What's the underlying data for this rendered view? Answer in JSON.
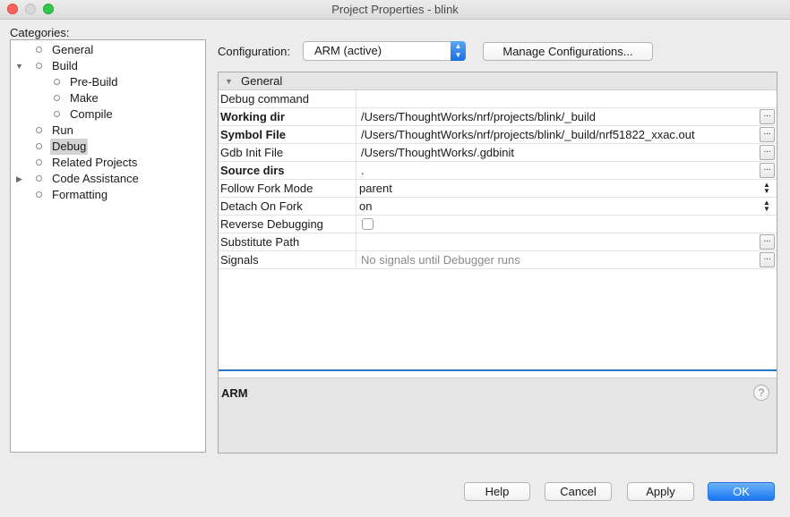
{
  "window": {
    "title": "Project Properties - blink"
  },
  "categories": {
    "label": "Categories:",
    "items": [
      {
        "label": "General"
      },
      {
        "label": "Build"
      },
      {
        "label": "Pre-Build"
      },
      {
        "label": "Make"
      },
      {
        "label": "Compile"
      },
      {
        "label": "Run"
      },
      {
        "label": "Debug",
        "selected": true
      },
      {
        "label": "Related Projects"
      },
      {
        "label": "Code Assistance"
      },
      {
        "label": "Formatting"
      }
    ]
  },
  "configuration": {
    "label": "Configuration:",
    "selected": "ARM (active)",
    "manage_label": "Manage Configurations..."
  },
  "sheet": {
    "group": "General",
    "rows": [
      {
        "name": "Debug command",
        "value": ""
      },
      {
        "name": "Working dir",
        "value": "/Users/ThoughtWorks/nrf/projects/blink/_build"
      },
      {
        "name": "Symbol File",
        "value": "/Users/ThoughtWorks/nrf/projects/blink/_build/nrf51822_xxac.out"
      },
      {
        "name": "Gdb Init File",
        "value": "/Users/ThoughtWorks/.gdbinit"
      },
      {
        "name": "Source dirs",
        "value": "."
      },
      {
        "name": "Follow Fork Mode",
        "value": "parent"
      },
      {
        "name": "Detach On Fork",
        "value": "on"
      },
      {
        "name": "Reverse Debugging",
        "value": "",
        "checked": false
      },
      {
        "name": "Substitute Path",
        "value": ""
      },
      {
        "name": "Signals",
        "value": "No signals until Debugger runs"
      }
    ],
    "ellipsis": "...",
    "description_title": "ARM",
    "help_glyph": "?"
  },
  "buttons": {
    "help": "Help",
    "cancel": "Cancel",
    "apply": "Apply",
    "ok": "OK"
  },
  "colors": {
    "accent": "#1976f0",
    "divider": "#2b76c6"
  }
}
